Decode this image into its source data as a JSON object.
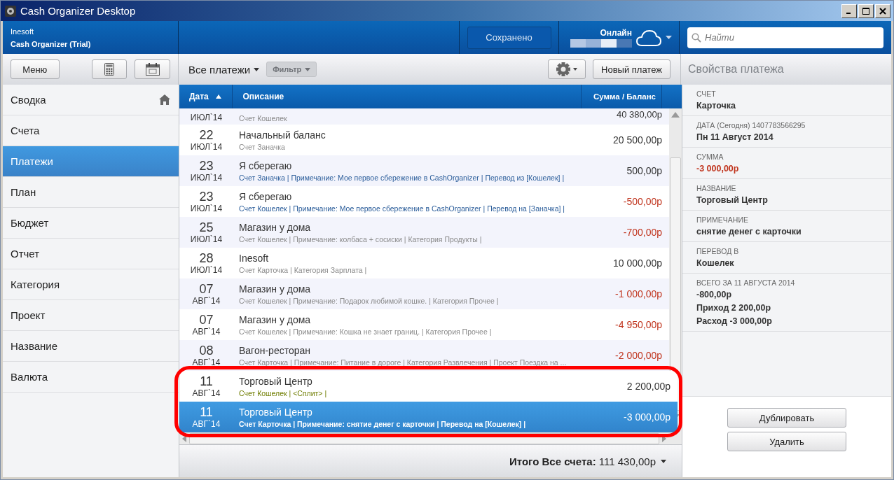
{
  "window": {
    "title": "Cash Organizer Desktop"
  },
  "header": {
    "company": "Inesoft",
    "product": "Cash Organizer (Trial)",
    "save_status": "Сохранено",
    "online_label": "Онлайн",
    "search": {
      "placeholder": "Найти"
    }
  },
  "toolbar": {
    "menu_button": "Меню",
    "view_selector": "Все платежи",
    "filter_button": {
      "label": "Фильтр",
      "disabled": true
    },
    "new_button": "Новый платеж"
  },
  "sidebar": {
    "items": [
      {
        "label": "Сводка",
        "selected": false,
        "has_icon": true
      },
      {
        "label": "Счета",
        "selected": false,
        "has_icon": false
      },
      {
        "label": "Платежи",
        "selected": true,
        "has_icon": false
      },
      {
        "label": "План",
        "selected": false,
        "has_icon": false
      },
      {
        "label": "Бюджет",
        "selected": false,
        "has_icon": false
      },
      {
        "label": "Отчет",
        "selected": false,
        "has_icon": false
      },
      {
        "label": "Категория",
        "selected": false,
        "has_icon": false
      },
      {
        "label": "Проект",
        "selected": false,
        "has_icon": false
      },
      {
        "label": "Название",
        "selected": false,
        "has_icon": false
      },
      {
        "label": "Валюта",
        "selected": false,
        "has_icon": false
      }
    ]
  },
  "table": {
    "columns": [
      {
        "label": "Дата",
        "sorted": true
      },
      {
        "label": "Описание",
        "sorted": false
      },
      {
        "label": "Сумма / Баланс",
        "sorted": false
      }
    ],
    "rows": [
      {
        "month": "ИЮЛ`14",
        "detail": "Счет Кошелек",
        "kind": "plain",
        "amount": "40 380,00р",
        "negative": false,
        "selected": false,
        "highlighted": false
      },
      {
        "day": "22",
        "month": "ИЮЛ`14",
        "title": "Начальный баланс",
        "detail": "Счет Заначка",
        "kind": "plain",
        "amount": "20 500,00р",
        "negative": false,
        "selected": false,
        "highlighted": false
      },
      {
        "day": "23",
        "month": "ИЮЛ`14",
        "title": "Я сберегаю",
        "detail": "Счет Заначка | Примечание: Мое первое сбережение в CashOrganizer | Перевод из [Кошелек] |",
        "kind": "transfer",
        "amount": "500,00р",
        "negative": false,
        "selected": false,
        "highlighted": false
      },
      {
        "day": "23",
        "month": "ИЮЛ`14",
        "title": "Я сберегаю",
        "detail": "Счет Кошелек | Примечание: Мое первое сбережение в CashOrganizer | Перевод на [Заначка] |",
        "kind": "transfer",
        "amount": "-500,00р",
        "negative": true,
        "selected": false,
        "highlighted": false
      },
      {
        "day": "25",
        "month": "ИЮЛ`14",
        "title": "Магазин у дома",
        "detail": "Счет Кошелек | Примечание: колбаса + сосиски | Категория Продукты |",
        "kind": "plain",
        "amount": "-700,00р",
        "negative": true,
        "selected": false,
        "highlighted": false
      },
      {
        "day": "28",
        "month": "ИЮЛ`14",
        "title": "Inesoft",
        "detail": "Счет Карточка | Категория Зарплата |",
        "kind": "plain",
        "amount": "10 000,00р",
        "negative": false,
        "selected": false,
        "highlighted": false
      },
      {
        "day": "07",
        "month": "АВГ`14",
        "title": "Магазин у дома",
        "detail": "Счет Кошелек | Примечание: Подарок любимой кошке. | Категория Прочее |",
        "kind": "plain",
        "amount": "-1 000,00р",
        "negative": true,
        "selected": false,
        "highlighted": false
      },
      {
        "day": "07",
        "month": "АВГ`14",
        "title": "Магазин у дома",
        "detail": "Счет Кошелек | Примечание: Кошка не знает границ. | Категория Прочее |",
        "kind": "plain",
        "amount": "-4 950,00р",
        "negative": true,
        "selected": false,
        "highlighted": false
      },
      {
        "day": "08",
        "month": "АВГ`14",
        "title": "Вагон-ресторан",
        "detail": "Счет Карточка | Примечание: Питание в дороге | Категория Развлечения | Проект Поездка на ...",
        "kind": "plain",
        "amount": "-2 000,00р",
        "negative": true,
        "selected": false,
        "highlighted": false
      },
      {
        "day": "11",
        "month": "АВГ`14",
        "title": "Торговый Центр",
        "detail": "Счет Кошелек | <Сплит> |",
        "kind": "split",
        "amount": "2 200,00р",
        "negative": false,
        "selected": false,
        "highlighted": true
      },
      {
        "day": "11",
        "month": "АВГ`14",
        "title": "Торговый Центр",
        "detail": "Счет Карточка | Примечание: снятие  денег с карточки | Перевод на [Кошелек] |",
        "kind": "transfer",
        "amount": "-3 000,00р",
        "negative": true,
        "selected": true,
        "highlighted": true
      }
    ]
  },
  "footer": {
    "total": "**Итого Все счета:** 111 430,00р"
  },
  "details": {
    "title": "Свойства платежа",
    "fields": [
      {
        "label": "СЧЕТ",
        "lines": [
          "Карточка"
        ],
        "negative": false
      },
      {
        "label": "ДАТА (Сегодня) 1407783566295",
        "lines": [
          "Пн 11 Август 2014"
        ],
        "negative": false
      },
      {
        "label": "СУММА",
        "lines": [
          "-3 000,00р"
        ],
        "negative": true
      },
      {
        "label": "НАЗВАНИЕ",
        "lines": [
          "Торговый Центр"
        ],
        "negative": false
      },
      {
        "label": "ПРИМЕЧАНИЕ",
        "lines": [
          "снятие  денег с карточки"
        ],
        "negative": false
      },
      {
        "label": "ПЕРЕВОД В",
        "lines": [
          "Кошелек"
        ],
        "negative": false
      },
      {
        "label": "ВСЕГО ЗА 11 АВГУСТА 2014",
        "lines": [
          "-800,00р",
          "Приход 2 200,00р",
          "Расход -3 000,00р"
        ],
        "negative": false
      }
    ],
    "buttons": [
      "Дублировать",
      "Удалить"
    ]
  }
}
